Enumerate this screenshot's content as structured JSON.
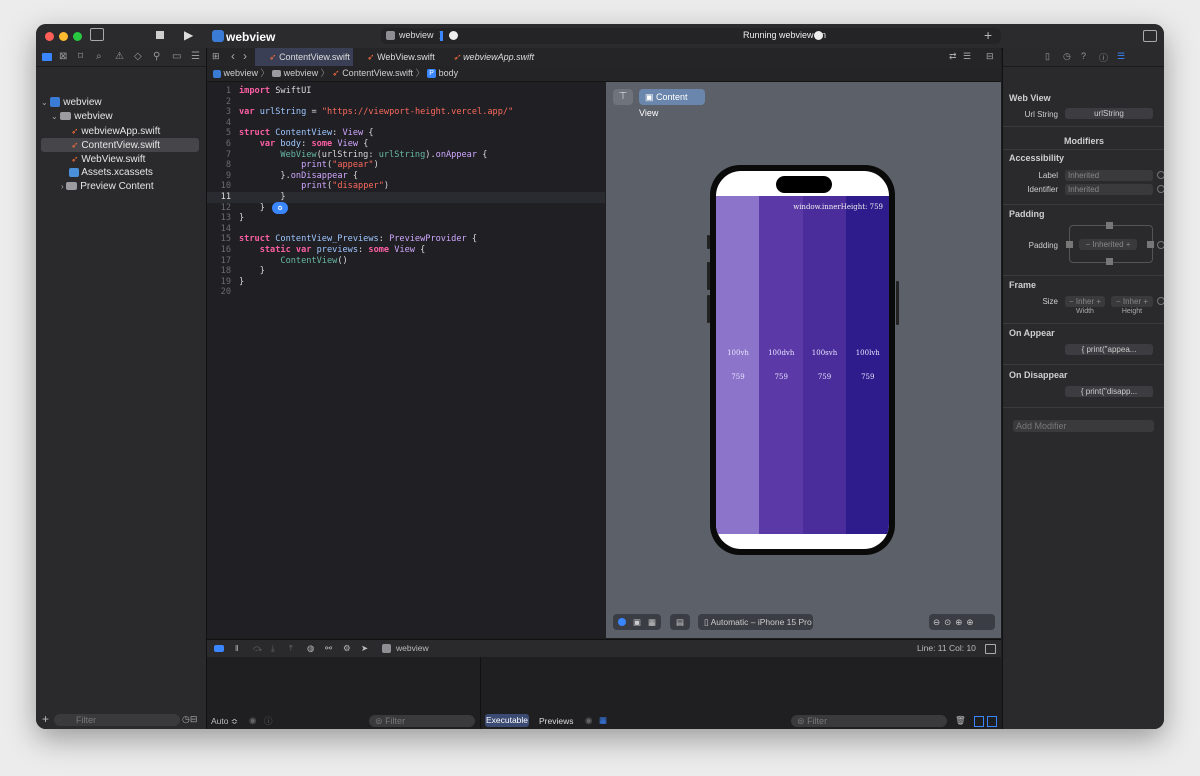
{
  "window": {
    "title": "webview",
    "status": "Running webview on",
    "scheme_target": "webview"
  },
  "navigator": {
    "items": [
      {
        "label": "webview",
        "level": 0,
        "kind": "project"
      },
      {
        "label": "webview",
        "level": 1,
        "kind": "folder"
      },
      {
        "label": "webviewApp.swift",
        "level": 2,
        "kind": "swift"
      },
      {
        "label": "ContentView.swift",
        "level": 2,
        "kind": "swift",
        "selected": true
      },
      {
        "label": "WebView.swift",
        "level": 2,
        "kind": "swift"
      },
      {
        "label": "Assets.xcassets",
        "level": 2,
        "kind": "assets"
      },
      {
        "label": "Preview Content",
        "level": 2,
        "kind": "folder"
      }
    ],
    "filter_placeholder": "Filter"
  },
  "editor": {
    "tabs": [
      {
        "label": "ContentView.swift",
        "active": true
      },
      {
        "label": "WebView.swift",
        "active": false
      },
      {
        "label": "webviewApp.swift",
        "active": false
      }
    ],
    "breadcrumb": [
      "webview",
      "webview",
      "ContentView.swift",
      "body"
    ],
    "current_line": 11,
    "lines": [
      [
        {
          "t": "import ",
          "c": "kw"
        },
        {
          "t": "SwiftUI",
          "c": ""
        }
      ],
      [],
      [
        {
          "t": "var ",
          "c": "kw"
        },
        {
          "t": "urlString",
          "c": "nm"
        },
        {
          "t": " = ",
          "c": ""
        },
        {
          "t": "\"https://viewport-height.vercel.app/\"",
          "c": "st"
        }
      ],
      [],
      [
        {
          "t": "struct ",
          "c": "kw"
        },
        {
          "t": "ContentView",
          "c": "nm"
        },
        {
          "t": ": ",
          "c": ""
        },
        {
          "t": "View",
          "c": "ty"
        },
        {
          "t": " {",
          "c": ""
        }
      ],
      [
        {
          "t": "    var ",
          "c": "kw"
        },
        {
          "t": "body",
          "c": "nm"
        },
        {
          "t": ": ",
          "c": ""
        },
        {
          "t": "some ",
          "c": "kw"
        },
        {
          "t": "View",
          "c": "ty"
        },
        {
          "t": " {",
          "c": ""
        }
      ],
      [
        {
          "t": "        WebView",
          "c": "fn"
        },
        {
          "t": "(urlString: ",
          "c": ""
        },
        {
          "t": "urlString",
          "c": "fn"
        },
        {
          "t": ").",
          "c": ""
        },
        {
          "t": "onAppear",
          "c": "ty"
        },
        {
          "t": " {",
          "c": ""
        }
      ],
      [
        {
          "t": "            print",
          "c": "ty"
        },
        {
          "t": "(",
          "c": ""
        },
        {
          "t": "\"appear\"",
          "c": "st"
        },
        {
          "t": ")",
          "c": ""
        }
      ],
      [
        {
          "t": "        }.",
          "c": ""
        },
        {
          "t": "onDisappear",
          "c": "ty"
        },
        {
          "t": " {",
          "c": ""
        }
      ],
      [
        {
          "t": "            print",
          "c": "ty"
        },
        {
          "t": "(",
          "c": ""
        },
        {
          "t": "\"disapper\"",
          "c": "st"
        },
        {
          "t": ")",
          "c": ""
        }
      ],
      [
        {
          "t": "        }",
          "c": ""
        }
      ],
      [
        {
          "t": "    }",
          "c": ""
        }
      ],
      [
        {
          "t": "}",
          "c": ""
        }
      ],
      [],
      [
        {
          "t": "struct ",
          "c": "kw"
        },
        {
          "t": "ContentView_Previews",
          "c": "nm"
        },
        {
          "t": ": ",
          "c": ""
        },
        {
          "t": "PreviewProvider",
          "c": "ty"
        },
        {
          "t": " {",
          "c": ""
        }
      ],
      [
        {
          "t": "    static ",
          "c": "kw"
        },
        {
          "t": "var ",
          "c": "kw"
        },
        {
          "t": "previews",
          "c": "nm"
        },
        {
          "t": ": ",
          "c": ""
        },
        {
          "t": "some ",
          "c": "kw"
        },
        {
          "t": "View",
          "c": "ty"
        },
        {
          "t": " {",
          "c": ""
        }
      ],
      [
        {
          "t": "        ContentView",
          "c": "fn"
        },
        {
          "t": "()",
          "c": ""
        }
      ],
      [
        {
          "t": "    }",
          "c": ""
        }
      ],
      [
        {
          "t": "}",
          "c": ""
        }
      ],
      []
    ]
  },
  "canvas": {
    "content_view_label": "Content View",
    "inner_height_label": "window.innerHeight: 759",
    "columns": [
      {
        "unit": "100vh",
        "value": "759",
        "color": "#8b74c9"
      },
      {
        "unit": "100dvh",
        "value": "759",
        "color": "#5b3aa8"
      },
      {
        "unit": "100svh",
        "value": "759",
        "color": "#4a2d9b"
      },
      {
        "unit": "100lvh",
        "value": "759",
        "color": "#2f1c8c"
      }
    ],
    "device_label": "Automatic – iPhone 15 Pro"
  },
  "debug": {
    "target": "webview",
    "line_col": "Line: 11  Col: 10",
    "auto_label": "Auto ≎",
    "filter_placeholder": "Filter",
    "executable_label": "Executable",
    "previews_label": "Previews"
  },
  "inspector": {
    "title": "Web View",
    "url_label": "Url String",
    "url_value": "urlString",
    "modifiers": "Modifiers",
    "accessibility": "Accessibility",
    "label_label": "Label",
    "identifier_label": "Identifier",
    "inherited": "Inherited",
    "padding_head": "Padding",
    "padding_label": "Padding",
    "frame_head": "Frame",
    "size_label": "Size",
    "inher": "Inher",
    "width_label": "Width",
    "height_label": "Height",
    "on_appear_head": "On Appear",
    "on_appear_value": "{ print(\"appea...",
    "on_disappear_head": "On Disappear",
    "on_disappear_value": "{ print(\"disapp...",
    "add_modifier": "Add Modifier"
  }
}
